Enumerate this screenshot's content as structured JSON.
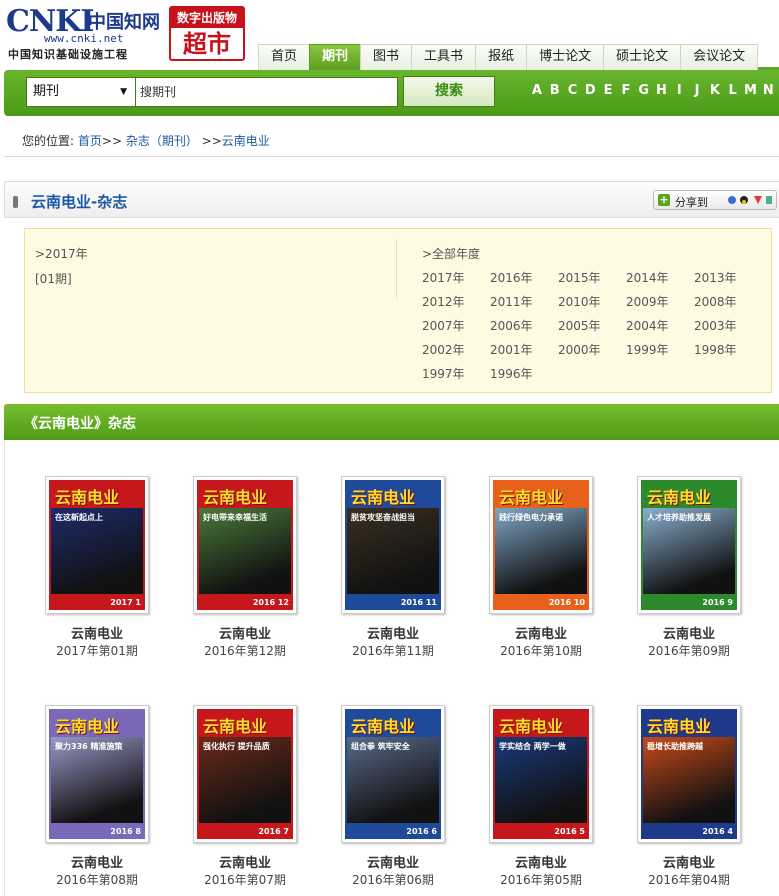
{
  "header": {
    "logo_cnki": "CNKI",
    "logo_cn": "中国知网",
    "logo_url": "www.cnki.net",
    "logo_sub": "中国知识基础设施工程",
    "badge_top": "数字出版物",
    "badge_bottom": "超市"
  },
  "nav": {
    "tabs": [
      {
        "label": "首页",
        "active": false
      },
      {
        "label": "期刊",
        "active": true
      },
      {
        "label": "图书",
        "active": false
      },
      {
        "label": "工具书",
        "active": false
      },
      {
        "label": "报纸",
        "active": false
      },
      {
        "label": "博士论文",
        "active": false
      },
      {
        "label": "硕士论文",
        "active": false
      },
      {
        "label": "会议论文",
        "active": false
      }
    ]
  },
  "search": {
    "select_value": "期刊",
    "input_placeholder": "搜期刊",
    "button_label": "搜索",
    "alphabet": [
      "A",
      "B",
      "C",
      "D",
      "E",
      "F",
      "G",
      "H",
      "I",
      "J",
      "K",
      "L",
      "M",
      "N"
    ]
  },
  "breadcrumb": {
    "prefix": "您的位置:",
    "home": "首页",
    "sep1": ">>",
    "journals": "杂志（期刊）",
    "sep2": ">>",
    "current": "云南电业"
  },
  "title": {
    "text": "云南电业-杂志",
    "share_label": "分享到"
  },
  "years": {
    "current_year": ">2017年",
    "current_issue": "[01期]",
    "all_label": ">全部年度",
    "list": [
      "2017年",
      "2016年",
      "2015年",
      "2014年",
      "2013年",
      "2012年",
      "2011年",
      "2010年",
      "2009年",
      "2008年",
      "2007年",
      "2006年",
      "2005年",
      "2004年",
      "2003年",
      "2002年",
      "2001年",
      "2000年",
      "1999年",
      "1998年",
      "1997年",
      "1996年"
    ]
  },
  "section": {
    "title": "《云南电业》杂志"
  },
  "issues": [
    {
      "name": "云南电业",
      "date": "2017年第01期",
      "cover_title": "云南电业",
      "slogan": "在这新起点上",
      "num": "2017 1",
      "bg": "#c6171c",
      "photo": "#1d2b6b",
      "band": "#c6171c"
    },
    {
      "name": "云南电业",
      "date": "2016年第12期",
      "cover_title": "云南电业",
      "slogan": "好电带来幸福生活",
      "num": "2016 12",
      "bg": "#c6171c",
      "photo": "#4a7a3a",
      "band": "#c6171c"
    },
    {
      "name": "云南电业",
      "date": "2016年第11期",
      "cover_title": "云南电业",
      "slogan": "脱贫攻坚奋战担当",
      "num": "2016 11",
      "bg": "#1f4a9a",
      "photo": "#3a3020",
      "band": "#1f4a9a"
    },
    {
      "name": "云南电业",
      "date": "2016年第10期",
      "cover_title": "云南电业",
      "slogan": "践行绿色电力承诺",
      "num": "2016 10",
      "bg": "#e8601a",
      "photo": "#7fa6c8",
      "band": "#e8601a"
    },
    {
      "name": "云南电业",
      "date": "2016年第09期",
      "cover_title": "云南电业",
      "slogan": "人才培养助推发展",
      "num": "2016 9",
      "bg": "#2c8a2c",
      "photo": "#8ab0d0",
      "band": "#2c8a2c"
    },
    {
      "name": "云南电业",
      "date": "2016年第08期",
      "cover_title": "云南电业",
      "slogan": "聚力336 精准施策",
      "num": "2016 8",
      "bg": "#7a68b8",
      "photo": "#9a98c8",
      "band": "#7a68b8"
    },
    {
      "name": "云南电业",
      "date": "2016年第07期",
      "cover_title": "云南电业",
      "slogan": "强化执行 提升品质",
      "num": "2016 7",
      "bg": "#c6171c",
      "photo": "#6a2a1a",
      "band": "#c6171c"
    },
    {
      "name": "云南电业",
      "date": "2016年第06期",
      "cover_title": "云南电业",
      "slogan": "组合拳 筑牢安全",
      "num": "2016 6",
      "bg": "#1f4a9a",
      "photo": "#5a6a8a",
      "band": "#1f4a9a"
    },
    {
      "name": "云南电业",
      "date": "2016年第05期",
      "cover_title": "云南电业",
      "slogan": "学实结合 两学一做",
      "num": "2016 5",
      "bg": "#c6171c",
      "photo": "#1a3a7a",
      "band": "#c6171c"
    },
    {
      "name": "云南电业",
      "date": "2016年第04期",
      "cover_title": "云南电业",
      "slogan": "稳增长助推跨越",
      "num": "2016 4",
      "bg": "#1f3a8a",
      "photo": "#c84a1a",
      "band": "#1f3a8a"
    }
  ]
}
